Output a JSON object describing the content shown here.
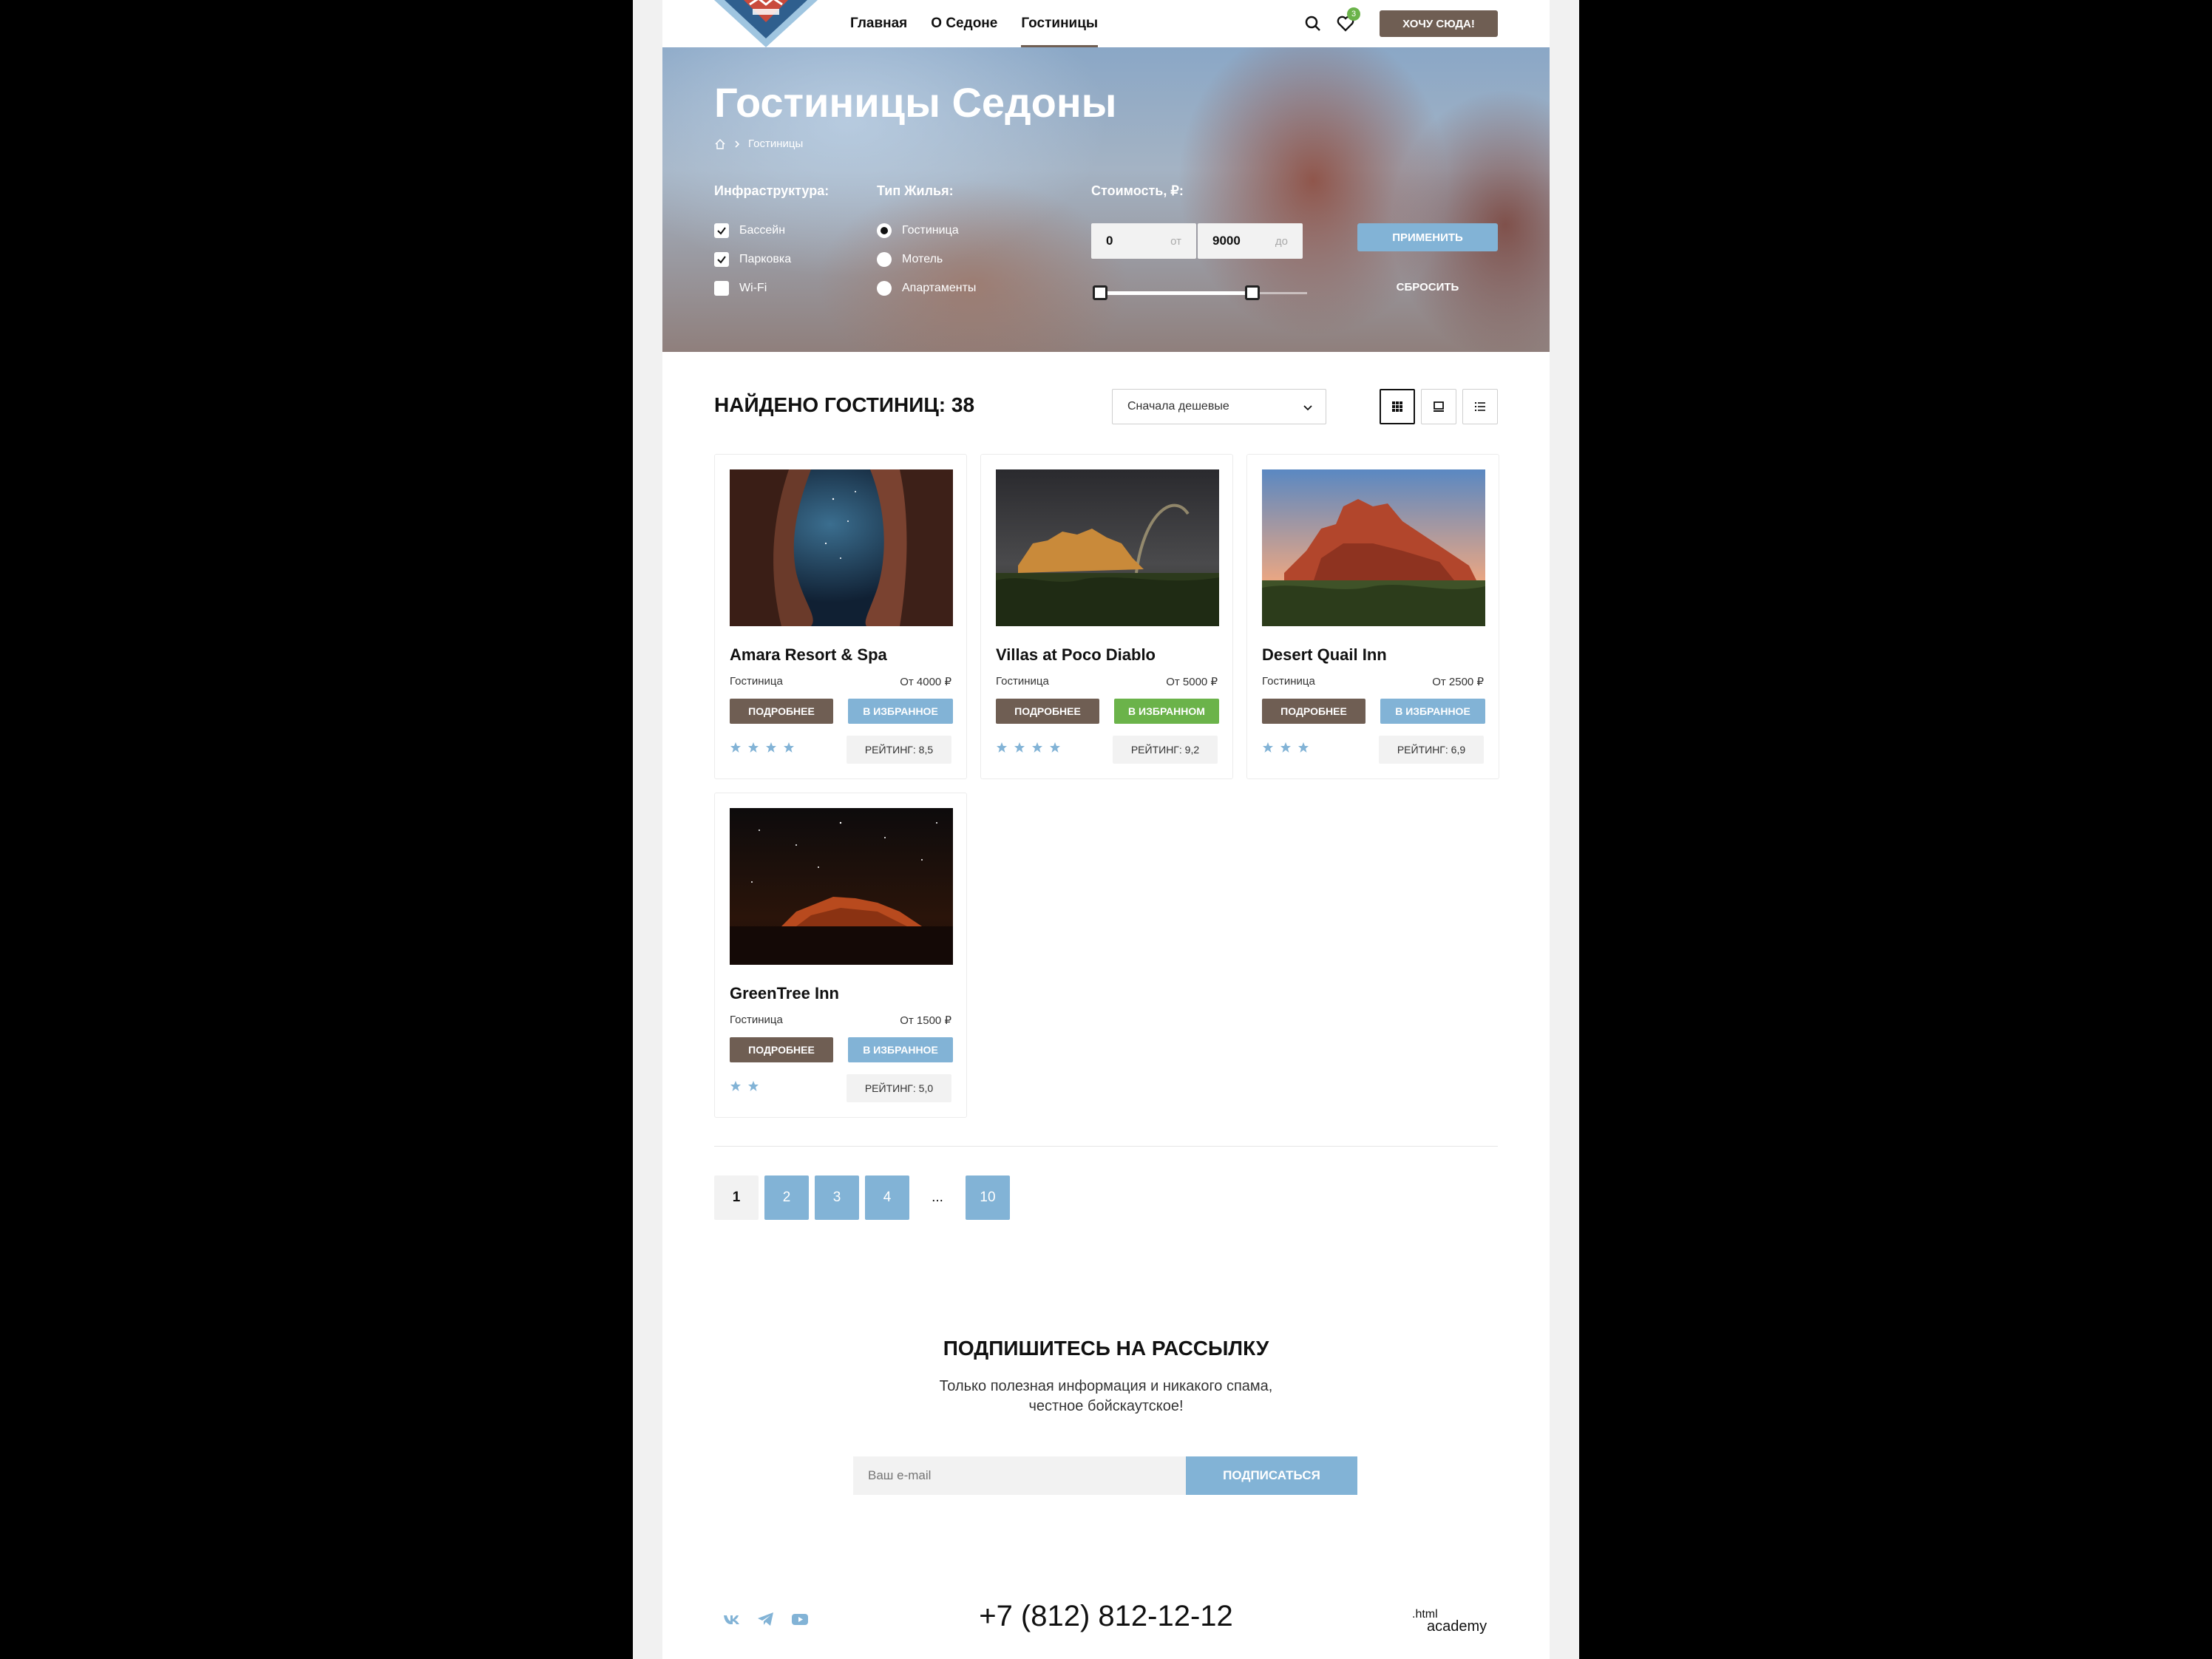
{
  "header": {
    "nav": [
      "Главная",
      "О Седоне",
      "Гостиницы"
    ],
    "active_nav": "Гостиницы",
    "favorites_count": "3",
    "cta": "ХОЧУ СЮДА!"
  },
  "hero": {
    "title": "Гостиницы Седоны",
    "breadcrumb": "Гостиницы"
  },
  "filters": {
    "infrastructure": {
      "title": "Инфраструктура:",
      "options": [
        {
          "label": "Бассейн",
          "checked": true
        },
        {
          "label": "Парковка",
          "checked": true
        },
        {
          "label": "Wi-Fi",
          "checked": false
        }
      ]
    },
    "type": {
      "title": "Тип Жилья:",
      "options": [
        {
          "label": "Гостиница",
          "selected": true
        },
        {
          "label": "Мотель",
          "selected": false
        },
        {
          "label": "Апартаменты",
          "selected": false
        }
      ]
    },
    "price": {
      "title": "Стоимость, ₽:",
      "from": "0",
      "from_unit": "от",
      "to": "9000",
      "to_unit": "до"
    },
    "apply": "ПРИМЕНИТЬ",
    "reset": "СБРОСИТЬ"
  },
  "results": {
    "found": "НАЙДЕНО ГОСТИНИЦ: 38",
    "sort": "Сначала дешевые",
    "view_modes": [
      "grid-icon",
      "card-icon",
      "list-icon"
    ],
    "active_view": "grid-icon"
  },
  "hotels": [
    {
      "name": "Amara Resort & Spa",
      "type": "Гостиница",
      "price": "От 4000 ₽",
      "more": "ПОДРОБНЕЕ",
      "fav": "В ИЗБРАННОЕ",
      "fav_active": false,
      "stars": 4,
      "rating": "РЕЙТИНГ: 8,5"
    },
    {
      "name": "Villas at Poco Diablo",
      "type": "Гостиница",
      "price": "От 5000 ₽",
      "more": "ПОДРОБНЕЕ",
      "fav": "В ИЗБРАННОМ",
      "fav_active": true,
      "stars": 4,
      "rating": "РЕЙТИНГ: 9,2"
    },
    {
      "name": "Desert Quail Inn",
      "type": "Гостиница",
      "price": "От 2500 ₽",
      "more": "ПОДРОБНЕЕ",
      "fav": "В ИЗБРАННОЕ",
      "fav_active": false,
      "stars": 3,
      "rating": "РЕЙТИНГ: 6,9"
    },
    {
      "name": "GreenTree Inn",
      "type": "Гостиница",
      "price": "От 1500 ₽",
      "more": "ПОДРОБНЕЕ",
      "fav": "В ИЗБРАННОЕ",
      "fav_active": false,
      "stars": 2,
      "rating": "РЕЙТИНГ: 5,0"
    }
  ],
  "pagination": [
    "1",
    "2",
    "3",
    "4",
    "...",
    "10"
  ],
  "pagination_current": "1",
  "subscribe": {
    "title": "ПОДПИШИТЕСЬ НА РАССЫЛКУ",
    "text_line1": "Только полезная информация и никакого спама,",
    "text_line2": "честное бойскаутское!",
    "placeholder": "Ваш e-mail",
    "button": "ПОДПИСАТЬСЯ"
  },
  "footer": {
    "social": [
      "vk-icon",
      "telegram-icon",
      "youtube-icon"
    ],
    "phone": "+7 (812) 812-12-12",
    "logo_text": ".html academy"
  },
  "colors": {
    "brown": "#6f5e53",
    "blue": "#82b3d6",
    "green": "#6bb34a"
  }
}
